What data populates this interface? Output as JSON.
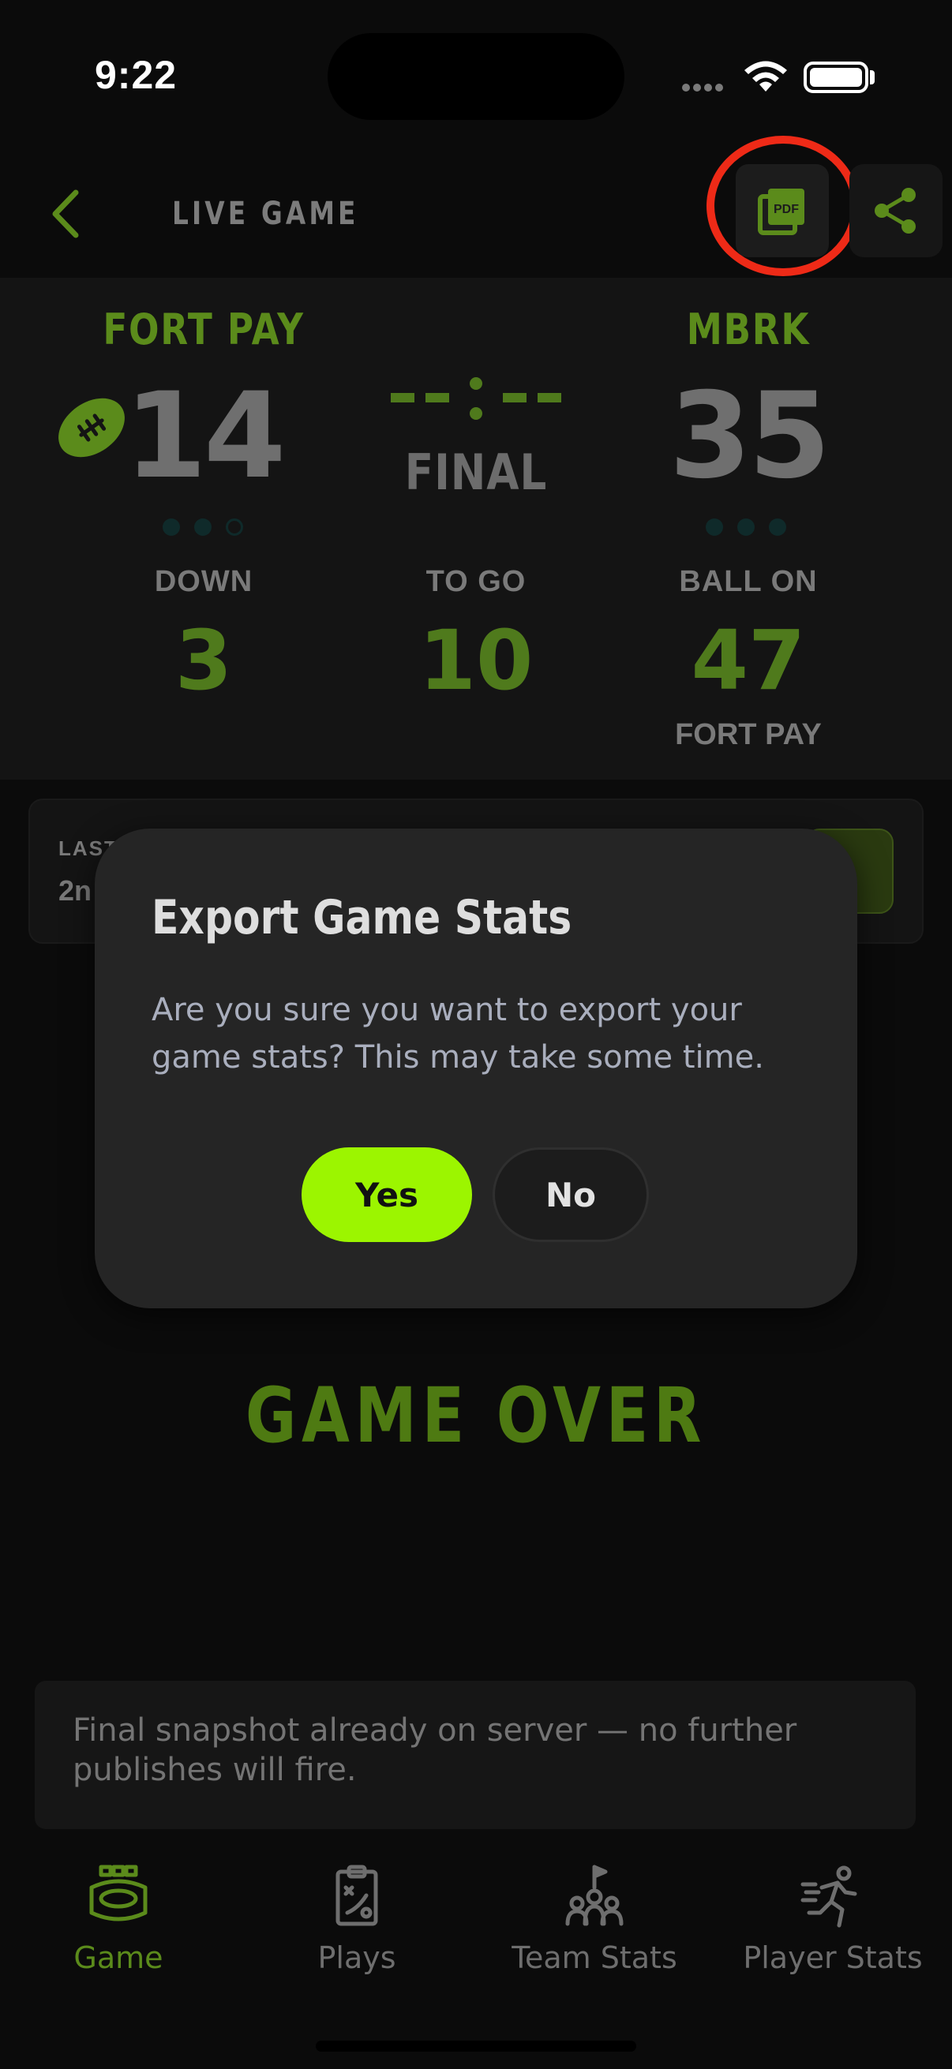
{
  "status_bar": {
    "time": "9:22"
  },
  "header": {
    "title": "LIVE GAME",
    "pdf_label": "PDF"
  },
  "scoreboard": {
    "home": {
      "name": "FORT PAY",
      "score": "14"
    },
    "away": {
      "name": "MBRK",
      "score": "35"
    },
    "period_label": "FINAL",
    "down": {
      "label": "DOWN",
      "value": "3"
    },
    "to_go": {
      "label": "TO GO",
      "value": "10"
    },
    "ball_on": {
      "label": "BALL ON",
      "value": "47",
      "team": "FORT PAY"
    }
  },
  "last_play": {
    "label": "LAST",
    "text": "2n"
  },
  "dialog": {
    "title": "Export Game Stats",
    "message": "Are you sure you want to export your game stats? This may take some time.",
    "yes_label": "Yes",
    "no_label": "No"
  },
  "game_over": "GAME OVER",
  "notice": "Final snapshot already on server — no further publishes will fire.",
  "tabs": [
    {
      "label": "Game",
      "icon": "stadium-icon",
      "active": true
    },
    {
      "label": "Plays",
      "icon": "clipboard-icon",
      "active": false
    },
    {
      "label": "Team Stats",
      "icon": "team-icon",
      "active": false
    },
    {
      "label": "Player Stats",
      "icon": "runner-icon",
      "active": false
    }
  ],
  "colors": {
    "accent": "#9cf500",
    "team_green": "#5b8b1b",
    "highlight_ring": "#ee2a17",
    "background": "#0b0b0b"
  }
}
